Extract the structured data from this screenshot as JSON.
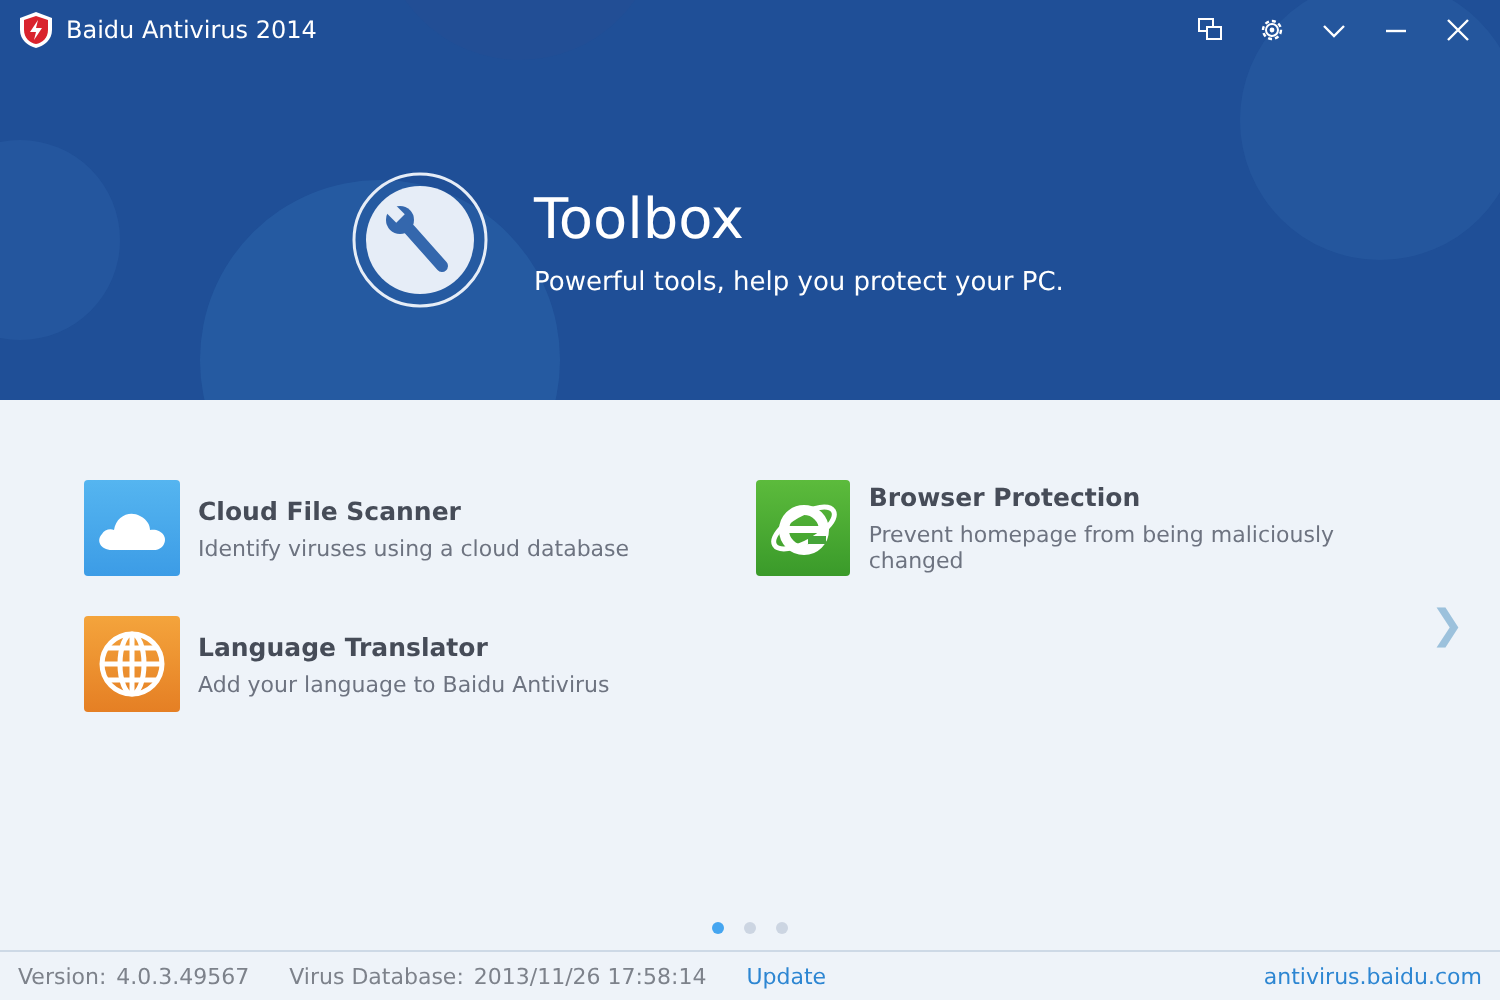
{
  "window": {
    "title": "Baidu Antivirus 2014"
  },
  "header": {
    "title": "Toolbox",
    "subtitle": "Powerful tools, help you protect your PC."
  },
  "tools": [
    {
      "kind": "cloud",
      "name": "Cloud File Scanner",
      "description": "Identify viruses using a cloud database"
    },
    {
      "kind": "browser",
      "name": "Browser Protection",
      "description": "Prevent homepage from being maliciously changed"
    },
    {
      "kind": "globe",
      "name": "Language Translator",
      "description": "Add your language to Baidu Antivirus"
    }
  ],
  "next_arrow": "❯",
  "pages": [
    {
      "selected": true
    },
    {
      "selected": false
    },
    {
      "selected": false
    }
  ],
  "status_bar": {
    "version_label": "Version:",
    "version": "4.0.3.49567",
    "database_label": "Virus Database:",
    "database": "2013/11/26 17:58:14",
    "update_link": "Update",
    "website_link": "antivirus.baidu.com"
  }
}
